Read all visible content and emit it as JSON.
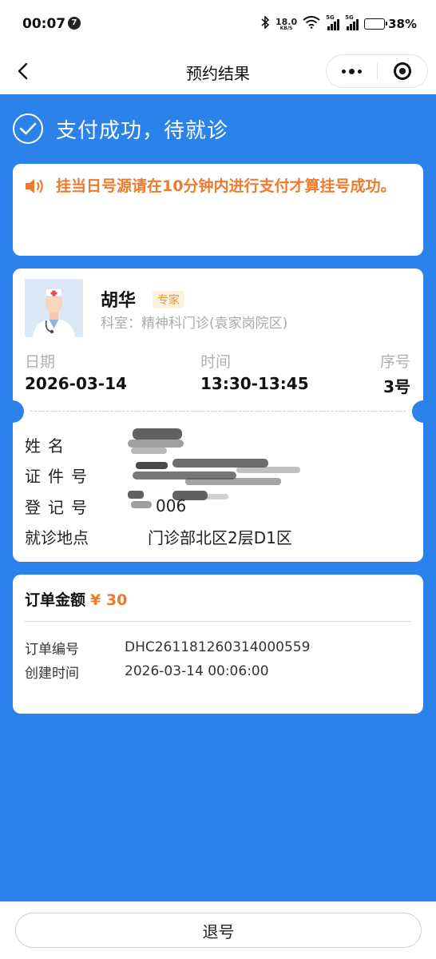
{
  "status_bar": {
    "time": "00:07",
    "notification_count": "7",
    "net_speed_value": "18.0",
    "net_speed_unit": "KB/S",
    "sim1_label": "5G",
    "sim2_label": "5G",
    "battery_percent": "38%",
    "battery_level": 0.38
  },
  "nav": {
    "title": "预约结果"
  },
  "result": {
    "title": "支付成功，待就诊"
  },
  "notice": {
    "text": "挂当日号源请在10分钟内进行支付才算挂号成功。"
  },
  "doctor": {
    "name": "胡华",
    "tag": "专家",
    "department": "科室：精神科门诊(袁家岗院区)"
  },
  "appointment": {
    "date_label": "日期",
    "date_value": "2026-03-14",
    "time_label": "时间",
    "time_value": "13:30-13:45",
    "seq_label": "序号",
    "seq_value": "3号"
  },
  "patient": {
    "name_label": "姓名",
    "id_label": "证件号",
    "reg_label": "登记号",
    "reg_value_partial": "006",
    "location_label": "就诊地点",
    "location_value": "门诊部北区2层D1区"
  },
  "order": {
    "amount_label": "订单金额",
    "amount_value": "¥ 30",
    "number_label": "订单编号",
    "number_value": "DHC261181260314000559",
    "created_label": "创建时间",
    "created_value": "2026-03-14 00:06:00"
  },
  "footer": {
    "refund_label": "退号"
  },
  "colors": {
    "primary_blue": "#2a82ea",
    "warning_orange": "#f07a2c",
    "tag_bg": "#fdf1df",
    "tag_text": "#e49838"
  }
}
